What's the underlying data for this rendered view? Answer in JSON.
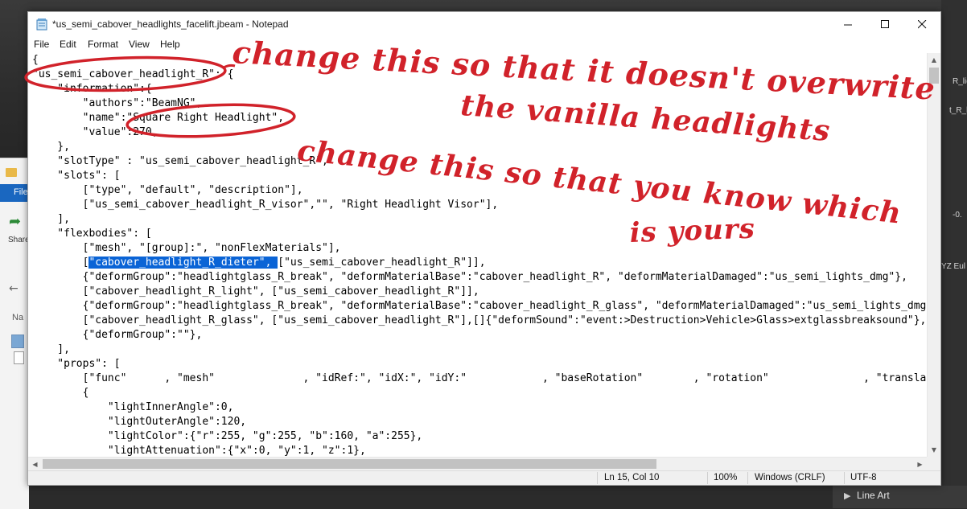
{
  "window": {
    "title": "*us_semi_cabover_headlights_facelift.jbeam - Notepad",
    "menu": [
      "File",
      "Edit",
      "Format",
      "View",
      "Help"
    ]
  },
  "editor": {
    "lines": [
      "{",
      "\"us_semi_cabover_headlight_R\": {",
      "    \"information\":{",
      "        \"authors\":\"BeamNG\",",
      "        \"name\":\"Square Right Headlight\",",
      "        \"value\":270,",
      "    },",
      "    \"slotType\" : \"us_semi_cabover_headlight_R\",",
      "    \"slots\": [",
      "        [\"type\", \"default\", \"description\"],",
      "        [\"us_semi_cabover_headlight_R_visor\",\"\", \"Right Headlight Visor\"],",
      "    ],",
      "    \"flexbodies\": [",
      "        [\"mesh\", \"[group]:\", \"nonFlexMaterials\"],",
      "        [\"cabover_headlight_R_dieter\", [\"us_semi_cabover_headlight_R\"]],",
      "        {\"deformGroup\":\"headlightglass_R_break\", \"deformMaterialBase\":\"cabover_headlight_R\", \"deformMaterialDamaged\":\"us_semi_lights_dmg\"},",
      "        [\"cabover_headlight_R_light\", [\"us_semi_cabover_headlight_R\"]],",
      "        {\"deformGroup\":\"headlightglass_R_break\", \"deformMaterialBase\":\"cabover_headlight_R_glass\", \"deformMaterialDamaged\":\"us_semi_lights_dmg\"},",
      "        [\"cabover_headlight_R_glass\", [\"us_semi_cabover_headlight_R\"],[]{\"deformSound\":\"event:>Destruction>Vehicle>Glass>extglassbreaksound\"},",
      "        {\"deformGroup\":\"\"},",
      "    ],",
      "    \"props\": [",
      "        [\"func\"      , \"mesh\"              , \"idRef:\", \"idX:\", \"idY:\"            , \"baseRotation\"        , \"rotation\"               , \"translation\"],",
      "        {",
      "            \"lightInnerAngle\":0,",
      "            \"lightOuterAngle\":120,",
      "            \"lightColor\":{\"r\":255, \"g\":255, \"b\":160, \"a\":255},",
      "            \"lightAttenuation\":{\"x\":0, \"y\":1, \"z\":1},"
    ],
    "selection": {
      "before": "        [",
      "selected": "\"cabover_headlight_R_dieter\", ",
      "after": "[\"us_semi_cabover_headlight_R\"]],"
    }
  },
  "status": {
    "position": "Ln 15, Col 10",
    "zoom": "100%",
    "line_endings": "Windows (CRLF)",
    "encoding": "UTF-8"
  },
  "annotations": {
    "note1_line1": "change this so that it doesn't overwrite",
    "note1_line2": "the vanilla headlights",
    "note2_line1": "change this so that you know which",
    "note2_line2": "is yours",
    "color": "#d1222a"
  },
  "background": {
    "explorer_file_tab": "File",
    "explorer_share": "Share",
    "explorer_nav": "Na",
    "right_panel_texts": [
      "R_ligh",
      "t_R_li",
      "-0.",
      "YZ Eul"
    ],
    "bottom_item": "Line Art"
  }
}
